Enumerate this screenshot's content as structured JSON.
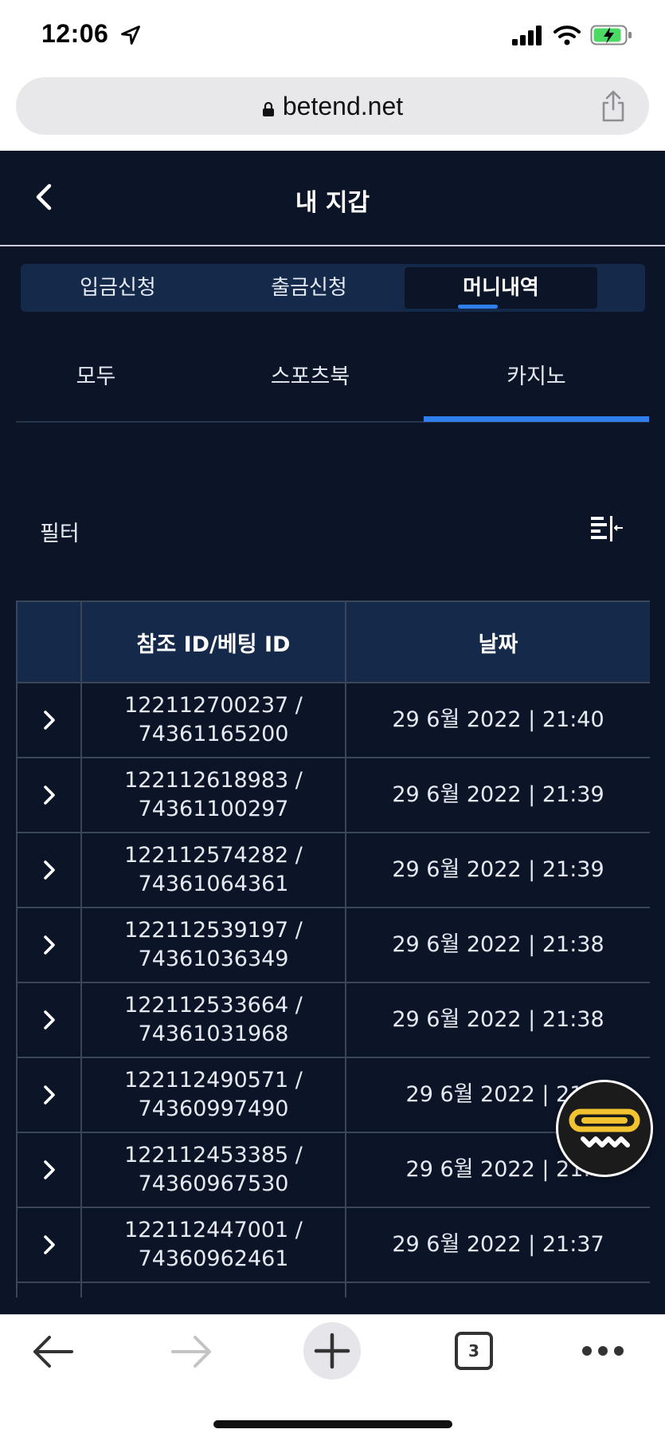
{
  "status_bar": {
    "time": "12:06"
  },
  "browser": {
    "url": "betend.net",
    "tab_count": "3"
  },
  "header": {
    "title": "내 지갑"
  },
  "top_tabs": [
    {
      "label": "입금신청",
      "active": false
    },
    {
      "label": "출금신청",
      "active": false
    },
    {
      "label": "머니내역",
      "active": true
    }
  ],
  "sub_tabs": [
    {
      "label": "모두",
      "active": false
    },
    {
      "label": "스포츠북",
      "active": false
    },
    {
      "label": "카지노",
      "active": true
    }
  ],
  "filter": {
    "label": "필터"
  },
  "table": {
    "columns": [
      "",
      "참조 ID/베팅 ID",
      "날짜"
    ],
    "rows": [
      {
        "ref_id": "122112700237 /",
        "bet_id": "74361165200",
        "date": "29 6월 2022 | 21:40"
      },
      {
        "ref_id": "122112618983 /",
        "bet_id": "74361100297",
        "date": "29 6월 2022 | 21:39"
      },
      {
        "ref_id": "122112574282 /",
        "bet_id": "74361064361",
        "date": "29 6월 2022 | 21:39"
      },
      {
        "ref_id": "122112539197 /",
        "bet_id": "74361036349",
        "date": "29 6월 2022 | 21:38"
      },
      {
        "ref_id": "122112533664 /",
        "bet_id": "74361031968",
        "date": "29 6월 2022 | 21:38"
      },
      {
        "ref_id": "122112490571 /",
        "bet_id": "74360997490",
        "date": "29 6월 2022 | 21:"
      },
      {
        "ref_id": "122112453385 /",
        "bet_id": "74360967530",
        "date": "29 6월 2022 | 21:"
      },
      {
        "ref_id": "122112447001 /",
        "bet_id": "74360962461",
        "date": "29 6월 2022 | 21:37"
      },
      {
        "ref_id": "",
        "bet_id": "",
        "date": ""
      }
    ]
  },
  "colors": {
    "background": "#0b1527",
    "accent": "#2f80ed",
    "tab_bar": "#15294a",
    "fab_yellow": "#f2c230"
  }
}
